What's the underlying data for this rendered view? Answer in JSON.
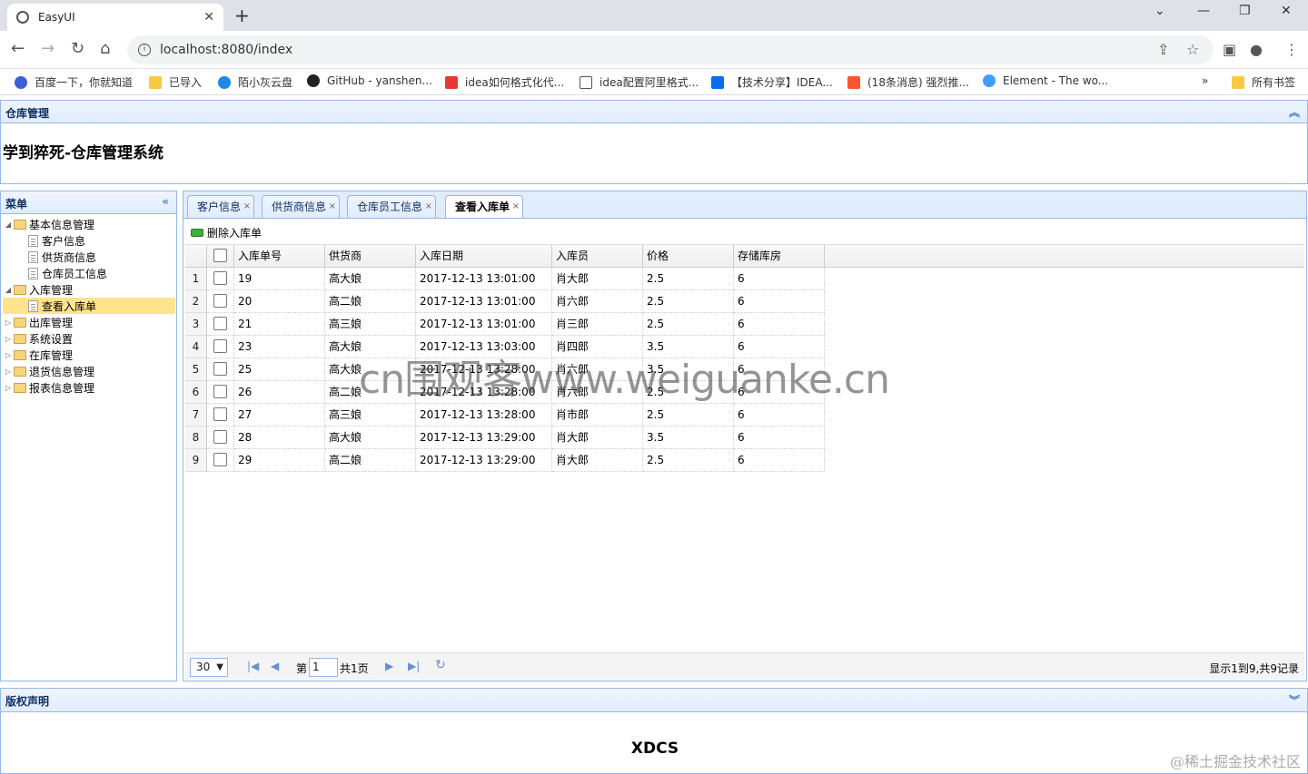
{
  "browser": {
    "tab_title": "EasyUI",
    "url": "localhost:8080/index",
    "bookmarks": [
      "百度一下，你就知道",
      "已导入",
      "陌小灰云盘",
      "GitHub - yanshen...",
      "idea如何格式化代...",
      "idea配置阿里格式...",
      "【技术分享】IDEA...",
      "(18条消息) 强烈推...",
      "Element - The wo...",
      "所有书签"
    ],
    "more_bookmarks": "»"
  },
  "north": {
    "header": "仓库管理",
    "site_title": "学到猝死-仓库管理系统"
  },
  "west": {
    "header": "菜单",
    "tree": [
      {
        "label": "基本信息管理",
        "type": "folder",
        "expanded": true,
        "level": 0
      },
      {
        "label": "客户信息",
        "type": "file",
        "level": 1
      },
      {
        "label": "供货商信息",
        "type": "file",
        "level": 1
      },
      {
        "label": "仓库员工信息",
        "type": "file",
        "level": 1
      },
      {
        "label": "入库管理",
        "type": "folder",
        "expanded": true,
        "level": 0
      },
      {
        "label": "查看入库单",
        "type": "file",
        "level": 1,
        "selected": true
      },
      {
        "label": "出库管理",
        "type": "folder",
        "expanded": false,
        "level": 0
      },
      {
        "label": "系统设置",
        "type": "folder",
        "expanded": false,
        "level": 0
      },
      {
        "label": "在库管理",
        "type": "folder",
        "expanded": false,
        "level": 0
      },
      {
        "label": "退货信息管理",
        "type": "folder",
        "expanded": false,
        "level": 0
      },
      {
        "label": "报表信息管理",
        "type": "folder",
        "expanded": false,
        "level": 0
      }
    ]
  },
  "tabs": [
    {
      "label": "客户信息",
      "active": false
    },
    {
      "label": "供货商信息",
      "active": false
    },
    {
      "label": "仓库员工信息",
      "active": false
    },
    {
      "label": "查看入库单",
      "active": true
    }
  ],
  "datagrid": {
    "toolbar_button": "删除入库单",
    "columns": [
      "入库单号",
      "供货商",
      "入库日期",
      "入库员",
      "价格",
      "存储库房"
    ],
    "rows": [
      [
        "19",
        "高大娘",
        "2017-12-13 13:01:00",
        "肖大郎",
        "2.5",
        "6"
      ],
      [
        "20",
        "高二娘",
        "2017-12-13 13:01:00",
        "肖六郎",
        "2.5",
        "6"
      ],
      [
        "21",
        "高三娘",
        "2017-12-13 13:01:00",
        "肖三郎",
        "2.5",
        "6"
      ],
      [
        "23",
        "高大娘",
        "2017-12-13 13:03:00",
        "肖四郎",
        "3.5",
        "6"
      ],
      [
        "25",
        "高大娘",
        "2017-12-13 13:28:00",
        "肖六郎",
        "3.5",
        "6"
      ],
      [
        "26",
        "高二娘",
        "2017-12-13 13:28:00",
        "肖六郎",
        "2.5",
        "6"
      ],
      [
        "27",
        "高三娘",
        "2017-12-13 13:28:00",
        "肖市郎",
        "2.5",
        "6"
      ],
      [
        "28",
        "高大娘",
        "2017-12-13 13:29:00",
        "肖大郎",
        "3.5",
        "6"
      ],
      [
        "29",
        "高二娘",
        "2017-12-13 13:29:00",
        "肖大郎",
        "2.5",
        "6"
      ]
    ],
    "pager": {
      "page_size": "30",
      "page_prefix": "第",
      "page_number": "1",
      "page_total": "共1页",
      "info": "显示1到9,共9记录"
    }
  },
  "south": {
    "header": "版权声明",
    "footer_text": "XDCS"
  },
  "overlays": {
    "watermark": "cn围观客www.weiguanke.cn",
    "credit": "@稀土掘金技术社区"
  }
}
